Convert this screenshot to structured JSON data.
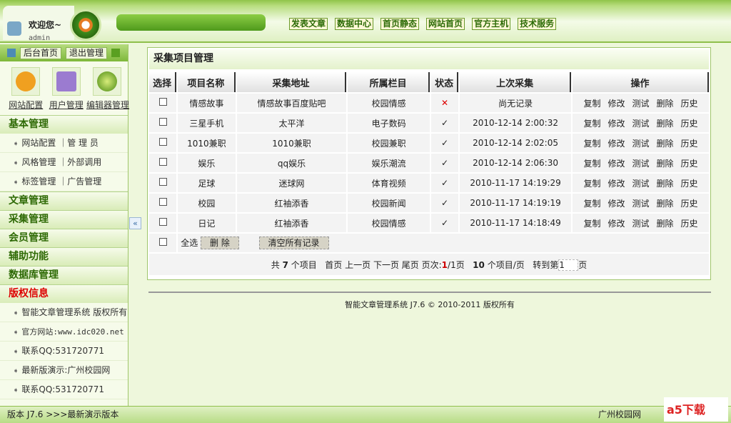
{
  "header": {
    "welcome": "欢迎您~",
    "user": "admin",
    "nav": [
      "发表文章",
      "数据中心",
      "首页静态",
      "网站首页",
      "官方主机",
      "技术服务"
    ]
  },
  "sidebar": {
    "home": "后台首页",
    "logout": "退出管理",
    "icons": [
      "网站配置",
      "用户管理",
      "编辑器管理"
    ],
    "sections": [
      {
        "title": "基本管理",
        "items": [
          "网站配置 ｜管 理 员",
          "风格管理 ｜外部调用",
          "标签管理 ｜广告管理"
        ]
      },
      {
        "title": "文章管理"
      },
      {
        "title": "采集管理"
      },
      {
        "title": "会员管理"
      },
      {
        "title": "辅助功能"
      },
      {
        "title": "数据库管理"
      }
    ],
    "copyright": {
      "title": "版权信息",
      "items": [
        "智能文章管理系统 版权所有",
        "官方网站:www.idc020.net",
        "联系QQ:531720771",
        "最新版演示:广州校园网",
        "联系QQ:531720771"
      ]
    },
    "collapse": "«"
  },
  "main": {
    "title": "采集项目管理",
    "columns": [
      "选择",
      "项目名称",
      "采集地址",
      "所属栏目",
      "状态",
      "上次采集",
      "操作"
    ],
    "rows": [
      {
        "name": "情感故事",
        "url": "情感故事百度贴吧",
        "cat": "校园情感",
        "status": "✕",
        "last": "尚无记录"
      },
      {
        "name": "三星手机",
        "url": "太平洋",
        "cat": "电子数码",
        "status": "✓",
        "last": "2010-12-14 2:00:32"
      },
      {
        "name": "1010兼职",
        "url": "1010兼职",
        "cat": "校园兼职",
        "status": "✓",
        "last": "2010-12-14 2:02:05"
      },
      {
        "name": "娱乐",
        "url": "qq娱乐",
        "cat": "娱乐潮流",
        "status": "✓",
        "last": "2010-12-14 2:06:30"
      },
      {
        "name": "足球",
        "url": "迷球网",
        "cat": "体育视频",
        "status": "✓",
        "last": "2010-11-17 14:19:29"
      },
      {
        "name": "校园",
        "url": "红袖添香",
        "cat": "校园新闻",
        "status": "✓",
        "last": "2010-11-17 14:19:19"
      },
      {
        "name": "日记",
        "url": "红袖添香",
        "cat": "校园情感",
        "status": "✓",
        "last": "2010-11-17 14:18:49"
      }
    ],
    "ops": [
      "复制",
      "修改",
      "测试",
      "删除",
      "历史"
    ],
    "select_all": "全选",
    "delete": "删 除",
    "clear": "清空所有记录",
    "pager": {
      "p1": "共",
      "total": "7",
      "p2": "个项目",
      "first": "首页",
      "prev": "上一页",
      "next": "下一页",
      "last": "尾页",
      "p3": "页次:",
      "cur": "1",
      "p4": "/1页",
      "per": "10",
      "p5": "个项目/页",
      "p6": "转到第",
      "goto": "1",
      "p7": "页"
    }
  },
  "footer": "智能文章管理系统 J7.6 © 2010-2011 版权所有",
  "bottom": {
    "version": "版本 J7.6 >>>最新演示版本",
    "link": "广州校园网",
    "badge": "a5下载"
  }
}
